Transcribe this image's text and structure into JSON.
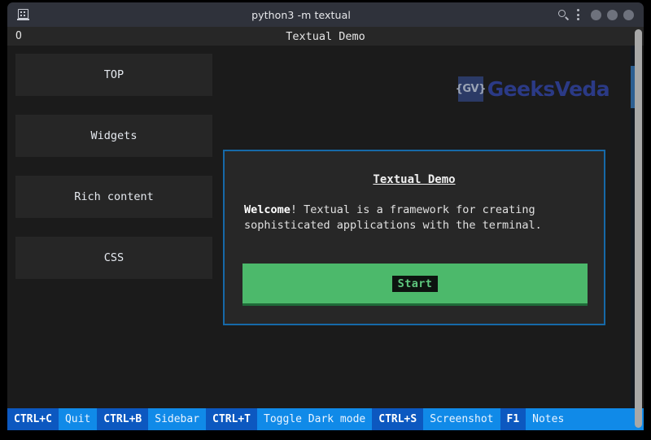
{
  "window": {
    "title": "python3 -m textual",
    "app_icon": "terminal-window-icon",
    "search_icon": "search-icon",
    "menu_icon": "kebab-menu-icon",
    "controls": [
      "minimize-button",
      "maximize-button",
      "close-button"
    ]
  },
  "tui": {
    "header_title": "Textual Demo",
    "clock": "O"
  },
  "sidebar": {
    "items": [
      {
        "label": "TOP"
      },
      {
        "label": "Widgets"
      },
      {
        "label": "Rich content"
      },
      {
        "label": "CSS"
      }
    ]
  },
  "logo": {
    "mark": "{GV}",
    "word": "GeeksVeda"
  },
  "panel": {
    "title": "Textual Demo",
    "welcome_bold": "Welcome",
    "welcome_rest": "! Textual is a framework for creating sophisticated applications with the terminal.",
    "button_label": "Start"
  },
  "footer": {
    "bindings": [
      {
        "key": "CTRL+C",
        "desc": "Quit"
      },
      {
        "key": "CTRL+B",
        "desc": "Sidebar"
      },
      {
        "key": "CTRL+T",
        "desc": "Toggle Dark mode"
      },
      {
        "key": "CTRL+S",
        "desc": "Screenshot"
      },
      {
        "key": "F1",
        "desc": "Notes"
      }
    ]
  },
  "colors": {
    "accent_border": "#1669a8",
    "start_button": "#4cb96b",
    "footer_key": "#0c58c0",
    "footer_desc": "#108ae8",
    "scroll_thumb": "#2d5f92"
  }
}
